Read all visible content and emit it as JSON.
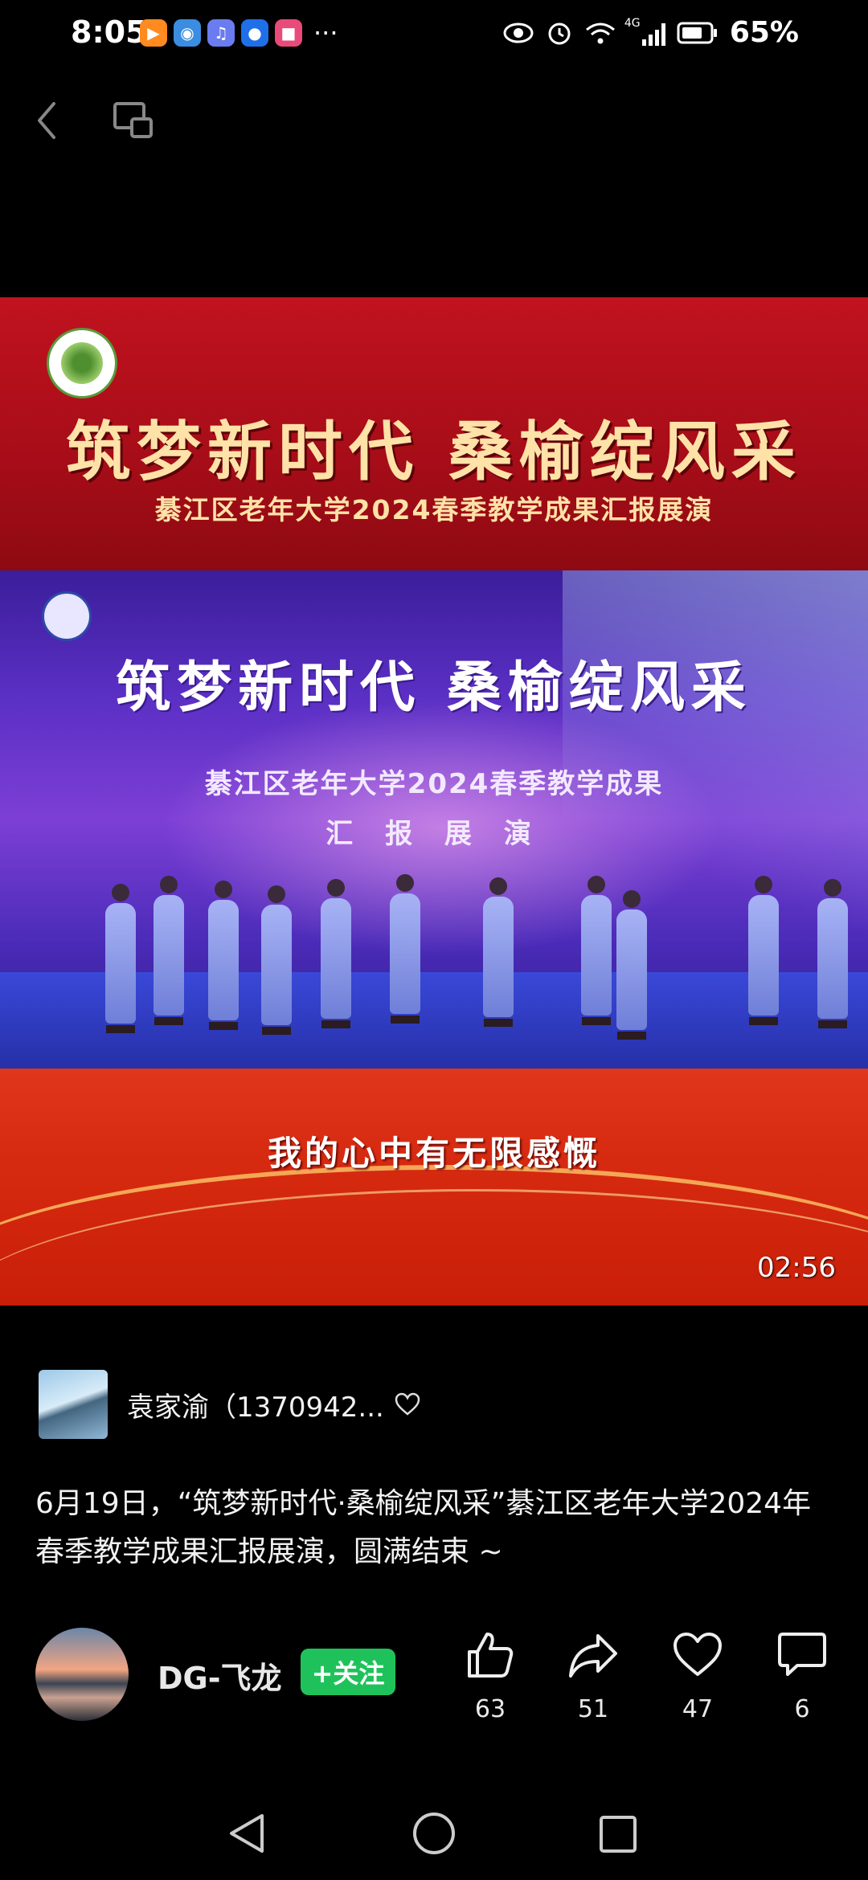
{
  "status_bar": {
    "time": "8:05",
    "battery_pct": "65%",
    "notification_icons": [
      "video-app-icon",
      "browser-icon",
      "music-icon",
      "assistant-icon",
      "store-icon"
    ],
    "signal_label": "4G"
  },
  "video": {
    "banner_title": "筑梦新时代  桑榆绽风采",
    "banner_subtitle": "綦江区老年大学2024春季教学成果汇报展演",
    "stage_title": "筑梦新时代  桑榆绽风采",
    "stage_subtitle_1": "綦江区老年大学2024春季教学成果",
    "stage_subtitle_2": "汇 报 展 演",
    "caption": "我的心中有无限感慨",
    "duration": "02:56",
    "colors": {
      "top_banner": "#c1121f",
      "stage": "#5a2fc4",
      "bottom_banner": "#d62a10",
      "gold_text": "#ffe2a8"
    }
  },
  "post": {
    "author_name": "袁家渝（1370942...",
    "description": "6月19日，“筑梦新时代·桑榆绽风采”綦江区老年大学2024年春季教学成果汇报展演，圆满结束 ~"
  },
  "bottom_bar": {
    "user_name": "DG-飞龙",
    "follow_label": "+关注",
    "follow_color": "#1fc25a",
    "actions": [
      {
        "name": "like",
        "icon": "thumbs-up-icon",
        "count": "63"
      },
      {
        "name": "share",
        "icon": "share-icon",
        "count": "51"
      },
      {
        "name": "favorite",
        "icon": "heart-icon",
        "count": "47"
      },
      {
        "name": "comment",
        "icon": "comment-icon",
        "count": "6"
      }
    ]
  }
}
